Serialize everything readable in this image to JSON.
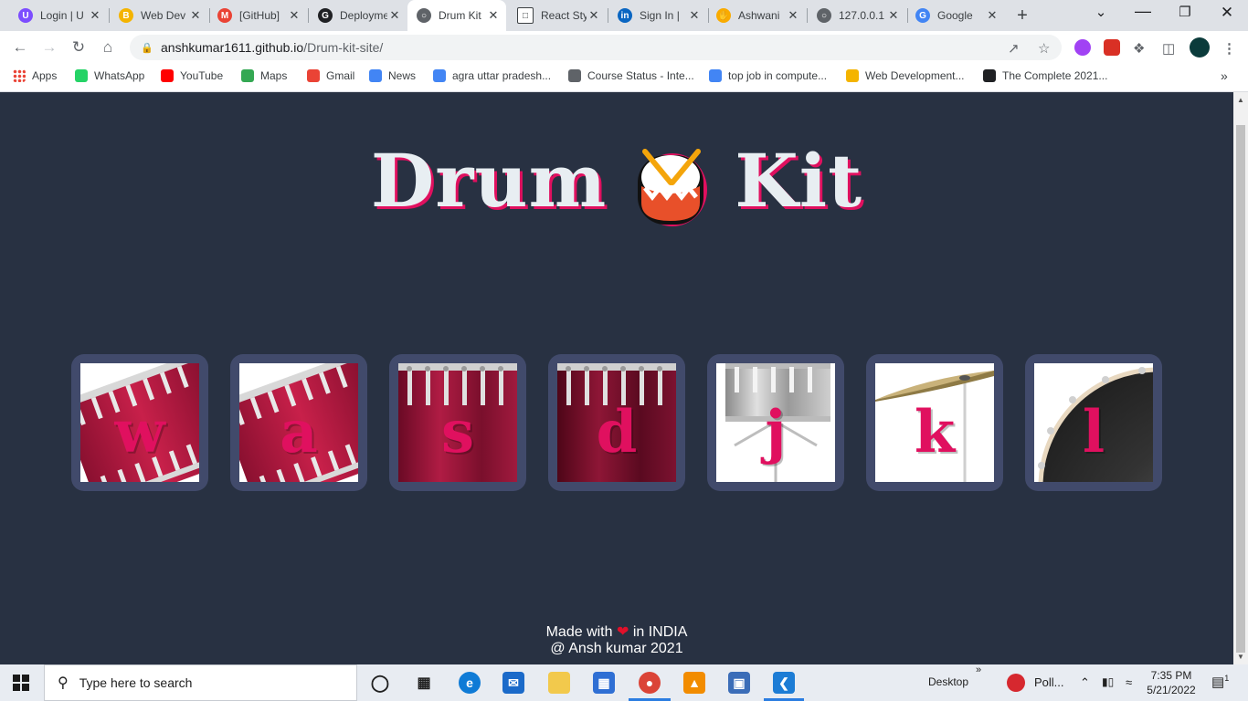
{
  "browser": {
    "tabs": [
      {
        "title": "Login | U",
        "favicon": "#7c4dff",
        "glyph": "U"
      },
      {
        "title": "Web Dev",
        "favicon": "#f4b400",
        "glyph": "B"
      },
      {
        "title": "[GitHub]",
        "favicon": "#ea4335",
        "glyph": "M"
      },
      {
        "title": "Deployme",
        "favicon": "#202124",
        "glyph": "G"
      },
      {
        "title": "Drum Kit",
        "favicon": "#5f6368",
        "glyph": "○"
      },
      {
        "title": "React Sty",
        "favicon": "#ffffff",
        "glyph": "□"
      },
      {
        "title": "Sign In |",
        "favicon": "#0a66c2",
        "glyph": "in"
      },
      {
        "title": "Ashwani",
        "favicon": "#f9ab00",
        "glyph": "✋"
      },
      {
        "title": "127.0.0.1",
        "favicon": "#5f6368",
        "glyph": "○"
      },
      {
        "title": "Google",
        "favicon": "#4285f4",
        "glyph": "G"
      }
    ],
    "active_tab": 4,
    "new_tab": "+",
    "url_host": "anshkumar1611.github.io",
    "url_path": "/Drum-kit-site/",
    "bookmarks": [
      {
        "label": "Apps",
        "color": "#ea4335"
      },
      {
        "label": "WhatsApp",
        "color": "#25d366"
      },
      {
        "label": "YouTube",
        "color": "#ff0000"
      },
      {
        "label": "Maps",
        "color": "#34a853"
      },
      {
        "label": "Gmail",
        "color": "#ea4335"
      },
      {
        "label": "News",
        "color": "#4285f4"
      },
      {
        "label": "agra uttar pradesh...",
        "color": "#4285f4"
      },
      {
        "label": "Course Status - Inte...",
        "color": "#5f6368"
      },
      {
        "label": "top job in compute...",
        "color": "#4285f4"
      },
      {
        "label": "Web Development...",
        "color": "#f4b400"
      },
      {
        "label": "The Complete 2021...",
        "color": "#202124"
      }
    ],
    "bookmarks_more": "»"
  },
  "page": {
    "title_left": "Drum",
    "title_right": "Kit",
    "keys": [
      {
        "letter": "w",
        "instrument": "tom-1"
      },
      {
        "letter": "a",
        "instrument": "tom-2"
      },
      {
        "letter": "s",
        "instrument": "tom-3"
      },
      {
        "letter": "d",
        "instrument": "tom-4"
      },
      {
        "letter": "j",
        "instrument": "snare"
      },
      {
        "letter": "k",
        "instrument": "crash"
      },
      {
        "letter": "l",
        "instrument": "kick"
      }
    ],
    "footer_line1_a": "Made with",
    "footer_line1_b": "in INDIA",
    "footer_line2": "@ Ansh kumar 2021"
  },
  "taskbar": {
    "search_placeholder": "Type here to search",
    "desktop_label": "Desktop",
    "desktop_chevron": "»",
    "pinned_app_label": "Poll...",
    "time": "7:35 PM",
    "date": "5/21/2022",
    "notification_count": "1"
  }
}
